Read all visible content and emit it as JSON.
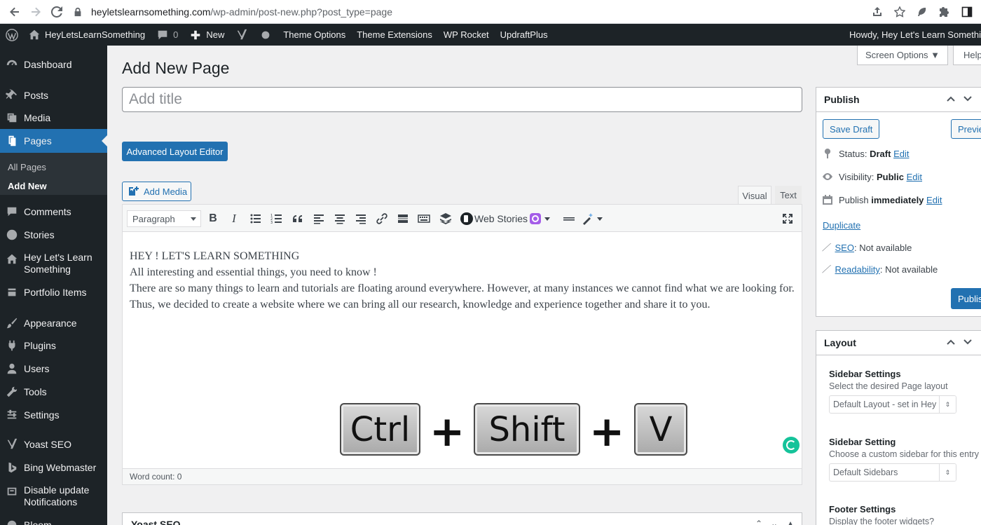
{
  "browser": {
    "url_host": "heyletslearnsomething.com",
    "url_path": "/wp-admin/post-new.php?post_type=page"
  },
  "adminbar": {
    "site_name": "HeyLetsLearnSomething",
    "comments_count": "0",
    "new_label": "New",
    "theme_options": "Theme Options",
    "theme_extensions": "Theme Extensions",
    "wp_rocket": "WP Rocket",
    "updraftplus": "UpdraftPlus",
    "howdy": "Howdy, Hey Let's Learn Somethi"
  },
  "sidebar": {
    "dashboard": "Dashboard",
    "posts": "Posts",
    "media": "Media",
    "pages": "Pages",
    "all_pages": "All Pages",
    "add_new": "Add New",
    "comments": "Comments",
    "stories": "Stories",
    "hey_lets_learn_1": "Hey Let's Learn",
    "hey_lets_learn_2": "Something",
    "portfolio": "Portfolio Items",
    "appearance": "Appearance",
    "plugins": "Plugins",
    "users": "Users",
    "tools": "Tools",
    "settings": "Settings",
    "yoast": "Yoast SEO",
    "bing": "Bing Webmaster",
    "disable_1": "Disable update",
    "disable_2": "Notifications",
    "bloom": "Bloom"
  },
  "header": {
    "screen_options": "Screen Options ▼",
    "help": "Help",
    "page_title": "Add New Page"
  },
  "editor": {
    "title_placeholder": "Add title",
    "advanced_layout_editor": "Advanced Layout Editor",
    "add_media": "Add Media",
    "tab_visual": "Visual",
    "tab_text": "Text",
    "paragraph_select": "Paragraph",
    "web_stories": "Web Stories",
    "content_line_1": "HEY ! LET'S LEARN SOMETHING",
    "content_line_2": "All interesting and essential things, you need to know !",
    "content_line_3": "There are so many things to learn and tutorials are floating around everywhere. However, at many instances we cannot find what we are looking for. Thus, we decided to create a website where we can bring all our research, knowledge and experience together and share it to you.",
    "key_ctrl": "Ctrl",
    "key_shift": "Shift",
    "key_v": "V",
    "plus": "+",
    "word_count": "Word count: 0"
  },
  "yoast_box": {
    "title": "Yoast SEO"
  },
  "publish": {
    "title": "Publish",
    "save_draft": "Save Draft",
    "preview": "Preview",
    "status_label": "Status:",
    "status_value": "Draft",
    "visibility_label": "Visibility:",
    "visibility_value": "Public",
    "publish_label": "Publish",
    "publish_value": "immediately",
    "edit": "Edit",
    "duplicate": "Duplicate",
    "seo_link": "SEO",
    "seo_value": ": Not available",
    "readability_link": "Readability",
    "readability_value": ": Not available",
    "publish_button": "Publish"
  },
  "layout": {
    "title": "Layout",
    "sidebar_settings_title": "Sidebar Settings",
    "sidebar_settings_desc": "Select the desired Page layout",
    "sidebar_settings_value": "Default Layout - set in Hey",
    "sidebar_setting_title": "Sidebar Setting",
    "sidebar_setting_desc": "Choose a custom sidebar for this entry",
    "sidebar_setting_value": "Default Sidebars",
    "footer_settings_title": "Footer Settings",
    "footer_settings_desc": "Display the footer widgets?"
  },
  "colors": {
    "accent": "#2271b1",
    "admin_dark": "#1d2327"
  }
}
